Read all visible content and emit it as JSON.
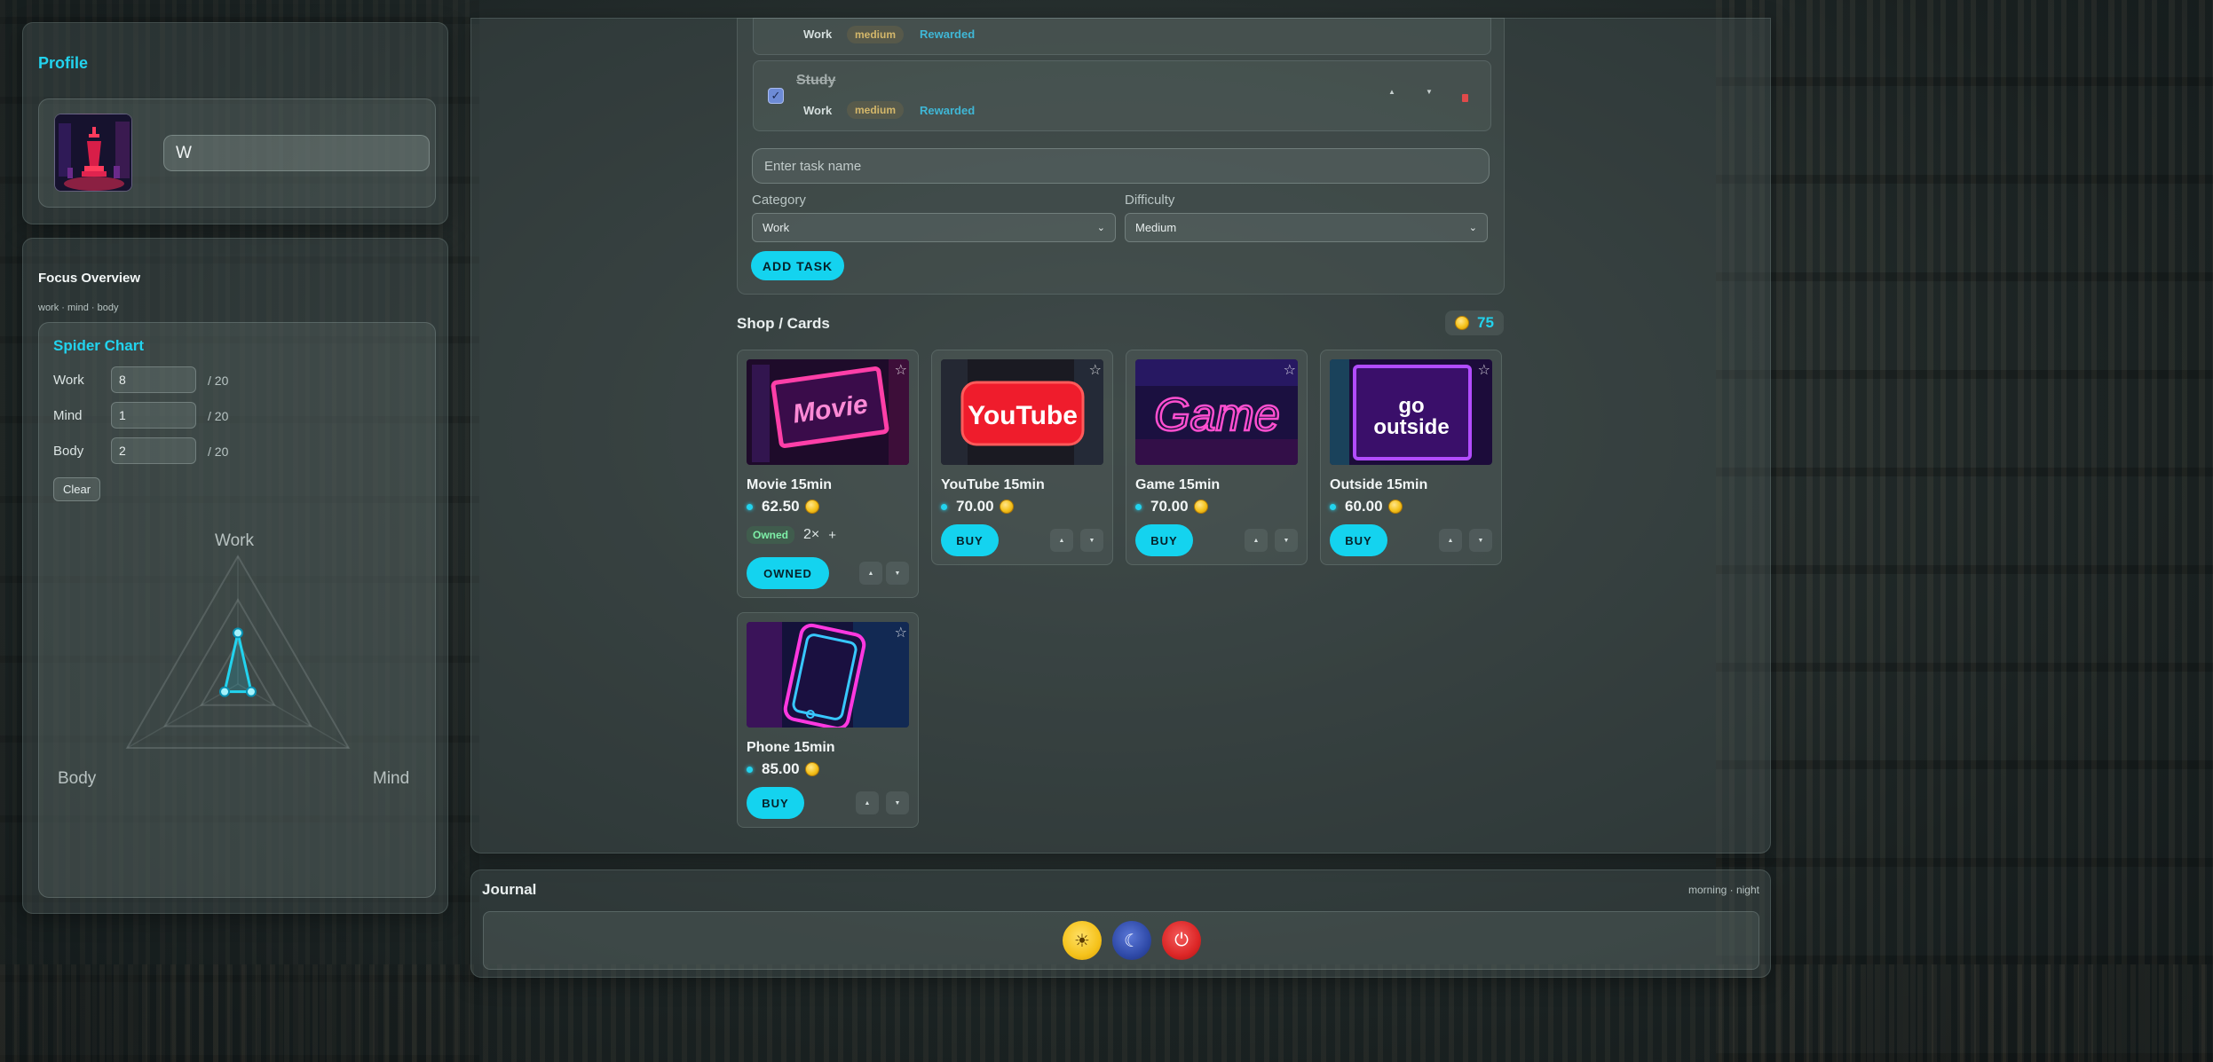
{
  "profile": {
    "title": "Profile",
    "name_value": "W"
  },
  "focus": {
    "title": "Focus Overview",
    "subtitle": "work · mind · body",
    "spider": {
      "title": "Spider Chart",
      "rows": [
        {
          "label": "Work",
          "value": "8",
          "max": "/ 20"
        },
        {
          "label": "Mind",
          "value": "1",
          "max": "/ 20"
        },
        {
          "label": "Body",
          "value": "2",
          "max": "/ 20"
        }
      ],
      "clear_label": "Clear",
      "axis_labels": {
        "top": "Work",
        "left": "Body",
        "right": "Mind"
      },
      "levels": {
        "work": 8,
        "mind": 1,
        "body": 2,
        "max": 20
      }
    }
  },
  "tasks": {
    "items": [
      {
        "name": "",
        "category": "Work",
        "difficulty": "medium",
        "status": "Rewarded"
      },
      {
        "name": "Study",
        "category": "Work",
        "difficulty": "medium",
        "status": "Rewarded"
      }
    ],
    "input_placeholder": "Enter task name",
    "category_label": "Category",
    "category_value": "Work",
    "difficulty_label": "Difficulty",
    "difficulty_value": "Medium",
    "add_label": "ADD TASK",
    "row_controls": {
      "up": "▲",
      "down": "▼"
    }
  },
  "shop": {
    "title": "Shop / Cards",
    "balance": "75",
    "cards": [
      {
        "title": "Movie 15min",
        "price": "62.50",
        "owned_badge": "Owned",
        "owned_count": "2×",
        "plus": "+",
        "button": "OWNED",
        "image_text": "Movie"
      },
      {
        "title": "YouTube 15min",
        "price": "70.00",
        "button": "BUY",
        "image_text": "YouTube"
      },
      {
        "title": "Game 15min",
        "price": "70.00",
        "button": "BUY",
        "image_text": "Game"
      },
      {
        "title": "Outside 15min",
        "price": "60.00",
        "button": "BUY",
        "image_text": "go outside"
      },
      {
        "title": "Phone 15min",
        "price": "85.00",
        "button": "BUY",
        "image_text": ""
      }
    ],
    "qty_controls": {
      "up": "▲",
      "down": "▼"
    }
  },
  "journal": {
    "title": "Journal",
    "subtitle": "morning · night",
    "buttons": [
      {
        "icon": "sun-icon",
        "color": "#f5c21b"
      },
      {
        "icon": "moon-icon",
        "color": "#2f4aa8"
      },
      {
        "icon": "power-icon",
        "color": "#dc2626"
      }
    ]
  },
  "colors": {
    "accent": "#14d3ef",
    "coin": "#f5c21b",
    "danger": "#e04a4a"
  }
}
